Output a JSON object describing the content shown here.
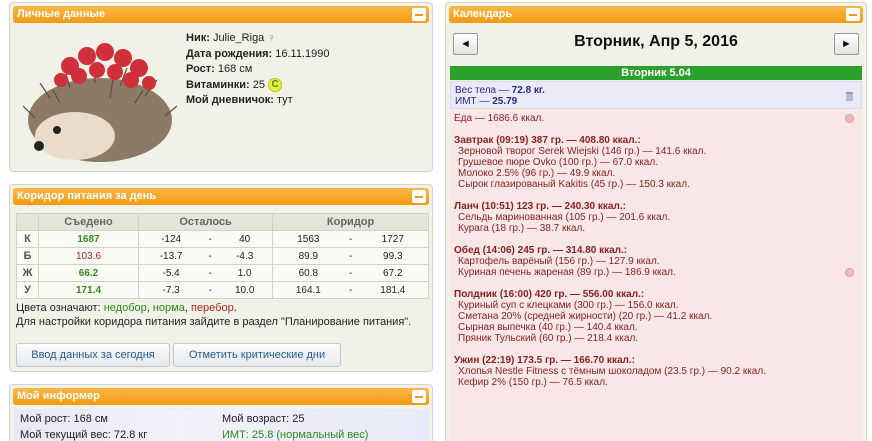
{
  "personal": {
    "title": "Личные данные",
    "nick_label": "Ник:",
    "nick": "Julie_Riga",
    "birth_label": "Дата рождения:",
    "birth": "16.11.1990",
    "height_label": "Рост:",
    "height": "168 см",
    "vitamin_label": "Витаминки:",
    "vitamin_value": "25",
    "vitamin_badge": "C",
    "diary_label": "Мой дневничок:",
    "diary": "тут"
  },
  "corridor": {
    "title": "Коридор питания за день",
    "headers": [
      "",
      "Съедено",
      "Осталось",
      "Коридор"
    ],
    "rows": [
      {
        "label": "К",
        "eaten": "1687",
        "left_min": "-124",
        "left_max": "40",
        "c_min": "1563",
        "c_max": "1727"
      },
      {
        "label": "Б",
        "eaten": "103.6",
        "left_min": "-13.7",
        "left_max": "-4.3",
        "c_min": "89.9",
        "c_max": "99.3"
      },
      {
        "label": "Ж",
        "eaten": "66.2",
        "left_min": "-5.4",
        "left_max": "1.0",
        "c_min": "60.8",
        "c_max": "67.2"
      },
      {
        "label": "У",
        "eaten": "171.4",
        "left_min": "-7.3",
        "left_max": "10.0",
        "c_min": "164.1",
        "c_max": "181.4"
      }
    ],
    "dash": "-",
    "note_prefix": "Цвета означают:",
    "note_under": "недобор",
    "note_norm": "норма",
    "note_over": "перебор",
    "note_line2": "Для настройки коридора питания зайдите в раздел \"Планирование питания\".",
    "btn_input": "Ввод данных за сегодня",
    "btn_critical": "Отметить критические дни"
  },
  "informer": {
    "title": "Мой информер",
    "height": "Мой рост: 168 см",
    "weight": "Мой текущий вес: 72.8 кг",
    "age": "Мой возраст: 25",
    "bmi": "ИМТ: 25.8 (нормальный вес)"
  },
  "calendar": {
    "title": "Календарь",
    "prev": "◄",
    "next": "►",
    "date": "Вторник, Апр 5, 2016",
    "day_head": "Вторник 5.04",
    "weight_line": "Вес тела — ",
    "weight_val": "72.8 кг.",
    "bmi_line": "ИМТ — ",
    "bmi_val": "25.79",
    "food_total": "Еда — 1686.6 ккал.",
    "meals": [
      {
        "title": "Завтрак (09:19) 387 гр. — 408.80 ккал.:",
        "items": [
          "Зерновой творог Serek Wiejski (146 гр.) — 141.6 ккал.",
          "Грушевое пюре Ovko (100 гр.) — 67.0 ккал.",
          "Молоко 2.5% (96 гр.) — 49.9 ккал.",
          "Сырок глазированый Kakitis (45 гр.) — 150.3 ккал."
        ]
      },
      {
        "title": "Ланч (10:51) 123 гр. — 240.30 ккал.:",
        "items": [
          "Сельдь маринованная (105 гр.) — 201.6 ккал.",
          "Курага (18 гр.) — 38.7 ккал."
        ]
      },
      {
        "title": "Обед (14:06) 245 гр. — 314.80 ккал.:",
        "items": [
          "Картофель варёный (156 гр.) — 127.9 ккал.",
          "Куриная печень жареная (89 гр.) — 186.9 ккал."
        ]
      },
      {
        "title": "Полдник (16:00) 420 гр. — 556.00 ккал.:",
        "items": [
          "Куриный суп с клецками (300 гр.) — 156.0 ккал.",
          "Сметана 20% (средней жирности) (20 гр.) — 41.2 ккал.",
          "Сырная выпечка (40 гр.) — 140.4 ккал.",
          "Пряник Тульский (60 гр.) — 218.4 ккал."
        ]
      },
      {
        "title": "Ужин (22:19) 173.5 гр. — 166.70 ккал.:",
        "items": [
          "Хлопья Nestle Fitness с тёмным шоколадом (23.5 гр.) — 90.2 ккал.",
          "Кефир 2% (150 гр.) — 76.5 ккал."
        ]
      }
    ]
  }
}
